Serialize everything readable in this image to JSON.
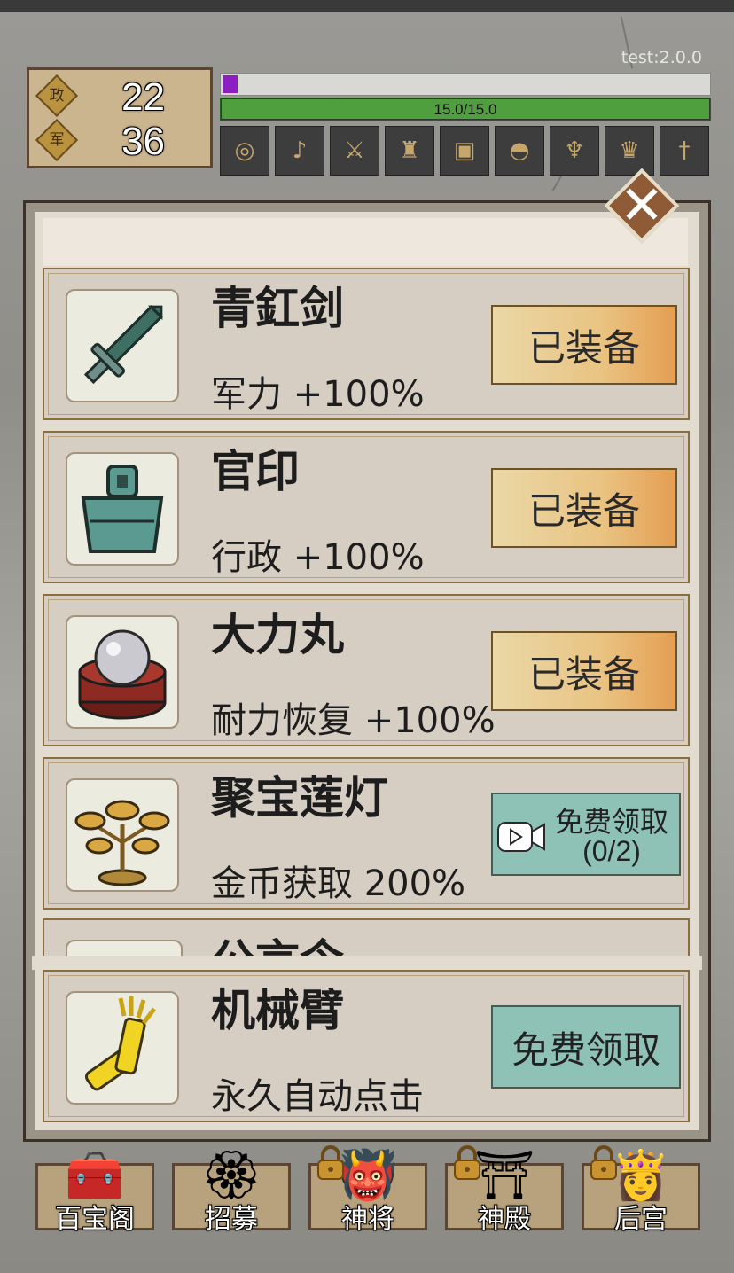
{
  "version": "test:2.0.0",
  "stats": {
    "admin": {
      "glyph": "政",
      "value": "22"
    },
    "military": {
      "glyph": "军",
      "value": "36"
    }
  },
  "bars": {
    "progress_fraction": 0.03,
    "stamina_text": "15.0/15.0",
    "stamina_fraction": 1.0,
    "colors": {
      "progress": "#8d1ec1",
      "stamina": "#4f9f3e"
    }
  },
  "slots": [
    "ring-icon",
    "pipa-icon",
    "crossbow-icon",
    "armor-icon",
    "seal-icon",
    "helmet-icon",
    "lotus-lamp-icon",
    "hat-icon",
    "sword-icon"
  ],
  "items": [
    {
      "name": "青釭剑",
      "desc": "军力 +100%",
      "icon": "sword-icon",
      "status": "equipped",
      "button": "已装备"
    },
    {
      "name": "官印",
      "desc": "行政 +100%",
      "icon": "seal-icon",
      "status": "equipped",
      "button": "已装备"
    },
    {
      "name": "大力丸",
      "desc": "耐力恢复 +100%",
      "icon": "pill-icon",
      "status": "equipped",
      "button": "已装备"
    },
    {
      "name": "聚宝莲灯",
      "desc": "金币获取 200%",
      "icon": "lotus-lamp-icon",
      "status": "free-video",
      "button": "免费领取",
      "button_sub": "(0/2)"
    }
  ],
  "peek_item": {
    "name": "公言令"
  },
  "pinned_item": {
    "name": "机械臂",
    "desc": "永久自动点击",
    "icon": "mech-arm-icon",
    "button": "免费领取"
  },
  "nav": [
    {
      "label": "百宝阁",
      "locked": false
    },
    {
      "label": "招募",
      "locked": false
    },
    {
      "label": "神将",
      "locked": true
    },
    {
      "label": "神殿",
      "locked": true
    },
    {
      "label": "后宫",
      "locked": true
    }
  ]
}
